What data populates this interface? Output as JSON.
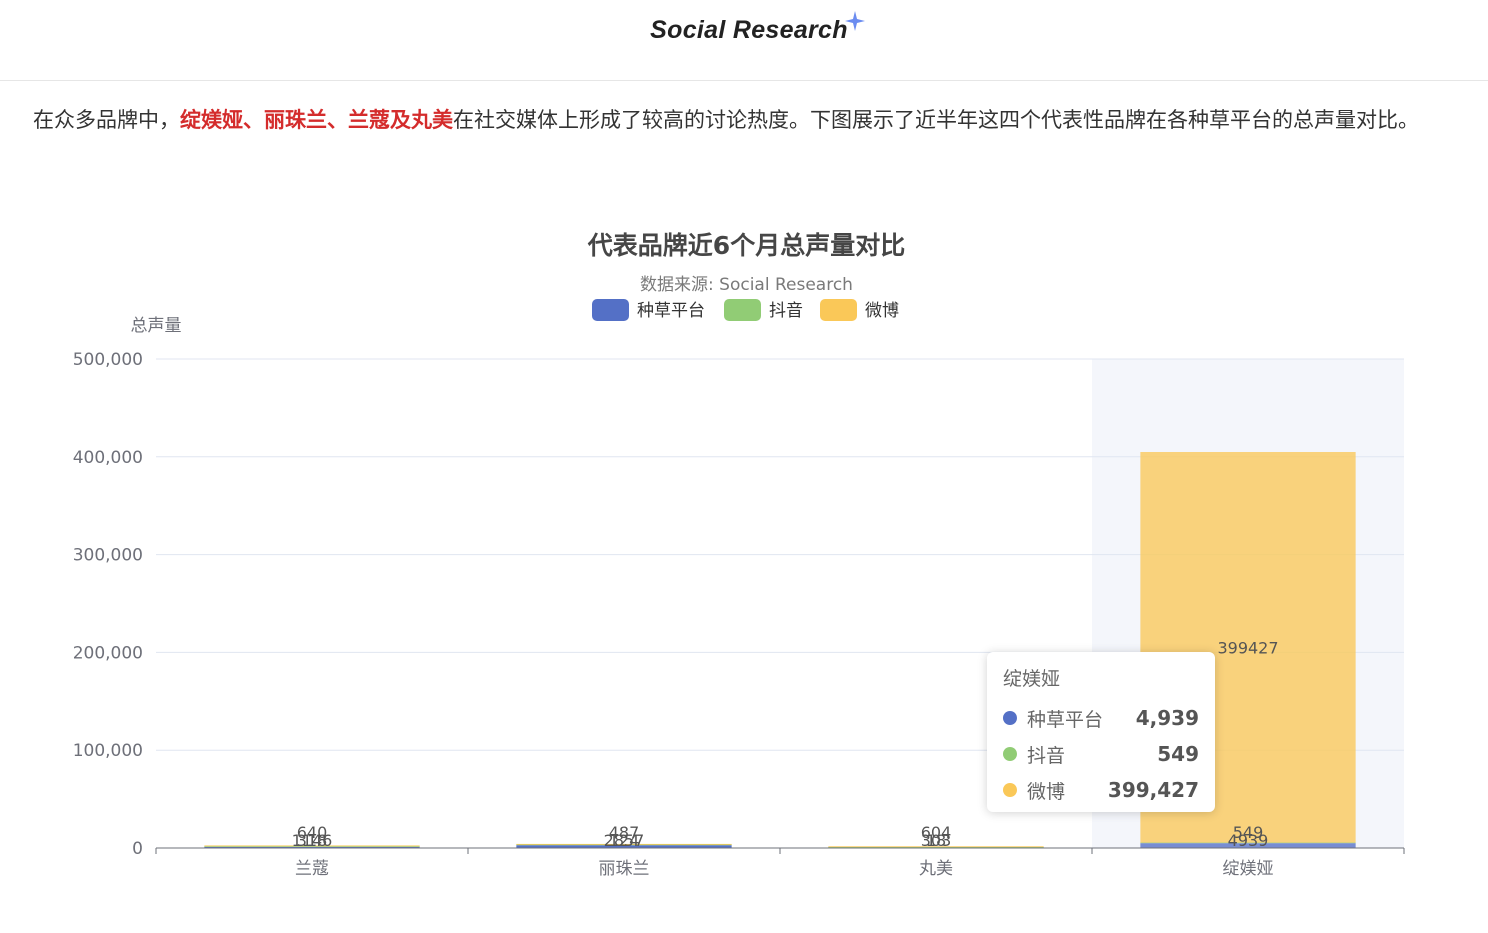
{
  "header": {
    "app_title": "Social Research"
  },
  "intro": {
    "prefix": "在众多品牌中，",
    "highlight": "绽媄娅、丽珠兰、兰蔻及丸美",
    "suffix": "在社交媒体上形成了较高的讨论热度。下图展示了近半年这四个代表性品牌在各种草平台的总声量对比。"
  },
  "colors": {
    "seeding": "#5470c6",
    "douyin": "#91cc75",
    "weibo": "#fac858",
    "highlight": "#d42c2c"
  },
  "chart_data": {
    "type": "bar",
    "stacked": true,
    "title": "代表品牌近6个月总声量对比",
    "subtitle": "数据来源: Social Research",
    "ylabel": "总声量",
    "xlabel": "",
    "ylim": [
      0,
      500000
    ],
    "y_ticks": [
      "0",
      "100,000",
      "200,000",
      "300,000",
      "400,000",
      "500,000"
    ],
    "y_tick_values": [
      0,
      100000,
      200000,
      300000,
      400000,
      500000
    ],
    "categories": [
      "兰蔻",
      "丽珠兰",
      "丸美",
      "绽媄娅"
    ],
    "legend_position": "top",
    "grid": true,
    "series": [
      {
        "name": "种草平台",
        "color": "#5470c6",
        "values": [
          1146,
          2857,
          303,
          4939
        ],
        "labels": [
          "1146",
          "2857",
          "303",
          "4939"
        ]
      },
      {
        "name": "抖音",
        "color": "#91cc75",
        "values": [
          640,
          487,
          604,
          549
        ],
        "labels": [
          "640",
          "487",
          "604",
          "549"
        ]
      },
      {
        "name": "微博",
        "color": "#fac858",
        "values": [
          318,
          124,
          18,
          399427
        ],
        "labels": [
          "318",
          "124",
          "18",
          "399427"
        ]
      }
    ],
    "highlighted_category": "绽媄娅"
  },
  "tooltip": {
    "title": "绽媄娅",
    "rows": [
      {
        "name": "种草平台",
        "value": "4,939",
        "color": "#5470c6"
      },
      {
        "name": "抖音",
        "value": "549",
        "color": "#91cc75"
      },
      {
        "name": "微博",
        "value": "399,427",
        "color": "#fac858"
      }
    ]
  }
}
